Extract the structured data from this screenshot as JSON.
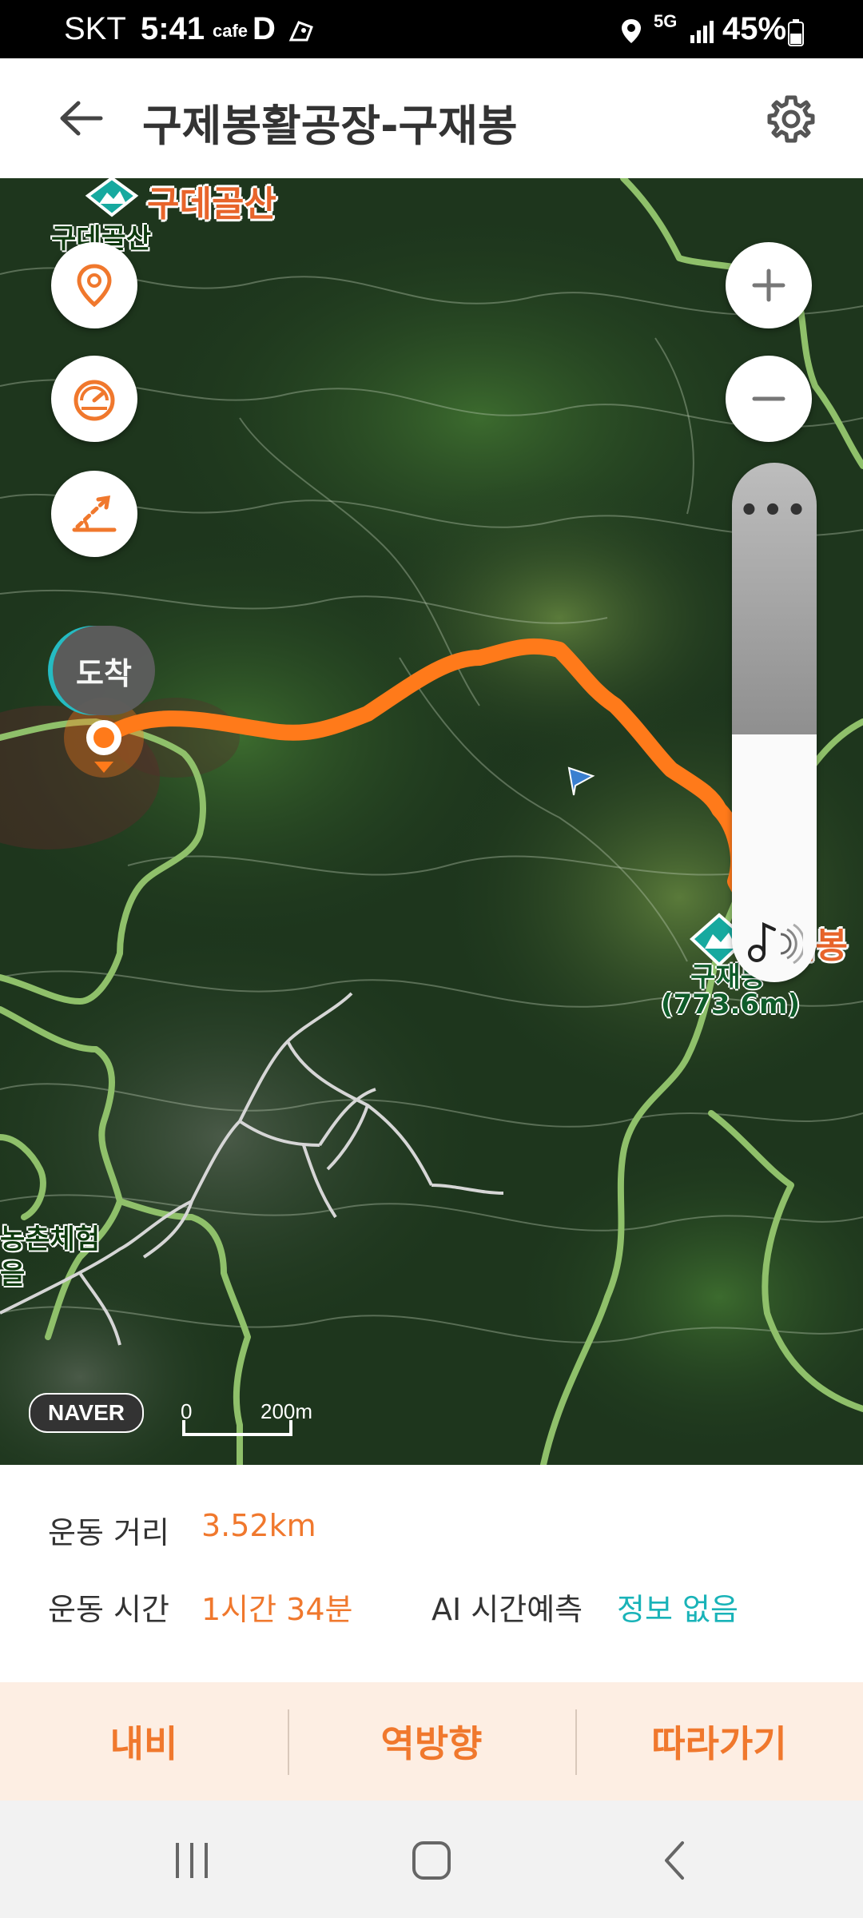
{
  "status_bar": {
    "carrier": "SKT",
    "time": "5:41",
    "cafe": "cafe",
    "d_app": "D",
    "network": "5G",
    "battery": "45%"
  },
  "header": {
    "title": "구제봉활공장-구재봉"
  },
  "map": {
    "labels": {
      "peak_top_name": "구데골산",
      "peak_top_caption": "구데골산",
      "summit_name": "구재봉",
      "summit_elevation": "(773.6m)",
      "summit_partial_label": "재봉",
      "village_line1": "농촌체험",
      "village_line2": "을"
    },
    "arrive_bubble": "도착",
    "more_label": "•••",
    "naver": "NAVER",
    "scale_zero": "0",
    "scale_distance": "200m"
  },
  "info": {
    "distance_label": "운동 거리",
    "distance_value": "3.52km",
    "time_label": "운동 시간",
    "time_value": "1시간 34분",
    "ai_label": "AI 시간예측",
    "ai_value": "정보 없음"
  },
  "actions": {
    "navi": "내비",
    "reverse": "역방향",
    "follow": "따라가기"
  },
  "colors": {
    "accent": "#f0782d",
    "teal": "#19b3b8",
    "route": "#ff7a1a",
    "trail": "#8fc06a"
  }
}
